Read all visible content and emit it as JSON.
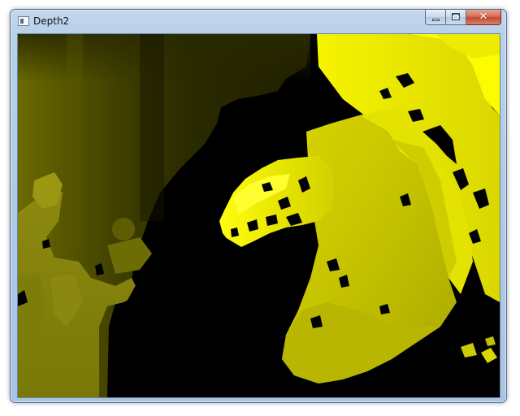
{
  "window": {
    "title": "Depth2"
  },
  "icons": {
    "app": "app-window-icon",
    "minimize": "minimize-icon",
    "maximize": "maximize-icon",
    "close": "close-icon"
  },
  "caption_buttons": {
    "close_glyph": "✕"
  },
  "image": {
    "description_type": "depth-map",
    "colors": {
      "background": "#000000",
      "bright": "#ffff00",
      "dark": "#202000"
    }
  }
}
